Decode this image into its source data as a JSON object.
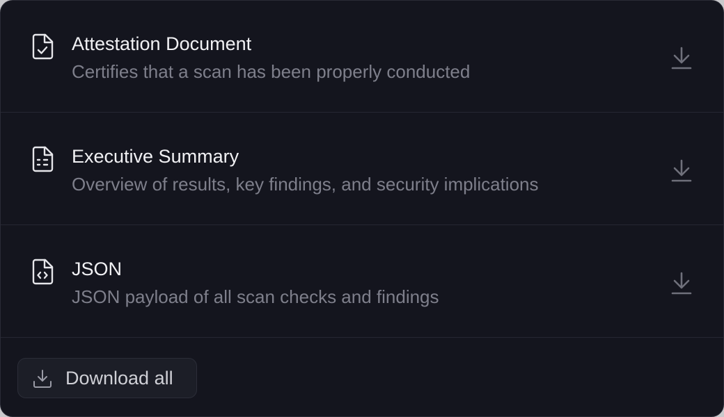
{
  "reports": [
    {
      "icon": "file-check-icon",
      "title": "Attestation Document",
      "description": "Certifies that a scan has been properly conducted"
    },
    {
      "icon": "file-text-icon",
      "title": "Executive Summary",
      "description": "Overview of results, key findings, and security implications"
    },
    {
      "icon": "file-code-icon",
      "title": "JSON",
      "description": "JSON payload of all scan checks and findings"
    }
  ],
  "download_all": {
    "label": "Download all",
    "icon": "download-icon"
  },
  "colors": {
    "background": "#14151e",
    "title": "#f1f1f4",
    "description": "#7e7f8b",
    "icon": "#e6e6ea",
    "download_icon": "#6f707b"
  }
}
